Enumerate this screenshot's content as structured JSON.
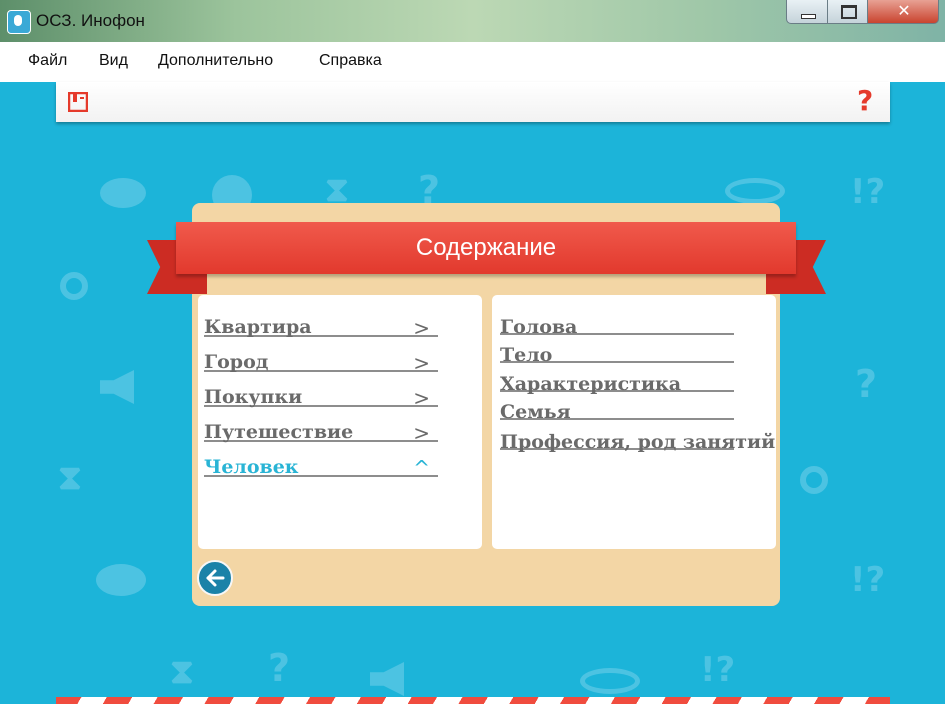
{
  "window": {
    "title": "ОСЗ. Инофон",
    "close_glyph": "✕"
  },
  "menu": {
    "file": "Файл",
    "view": "Вид",
    "extra": "Дополнительно",
    "help": "Справка"
  },
  "toolbar": {
    "book_icon": "book-icon",
    "help_glyph": "?"
  },
  "contents": {
    "title": "Содержание",
    "topics": [
      {
        "label": "Квартира",
        "arrow": ">"
      },
      {
        "label": "Город",
        "arrow": ">"
      },
      {
        "label": "Покупки",
        "arrow": ">"
      },
      {
        "label": "Путешествие",
        "arrow": ">"
      },
      {
        "label": "Человек",
        "arrow": "^",
        "active": true
      }
    ],
    "subtopics": [
      "Голова",
      "Тело",
      "Характеристика",
      "Семья",
      "Профессия, род занятий"
    ]
  },
  "colors": {
    "background": "#1cb4d9",
    "ribbon": "#e53a2b",
    "panel": "#f3d6a5",
    "active_topic": "#29b4d5",
    "text": "#6a6a6a"
  },
  "icons": {
    "back": "arrow-left-icon",
    "help": "question-icon"
  }
}
